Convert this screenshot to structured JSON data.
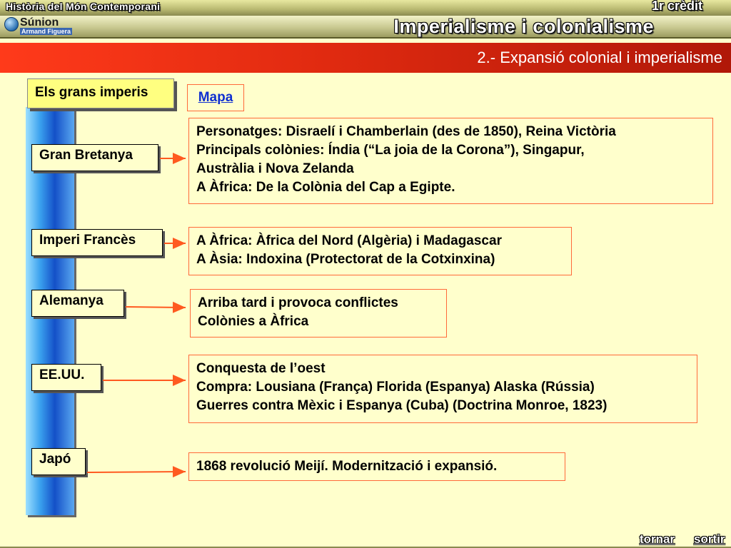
{
  "header": {
    "course": "Història del Món Contemporani",
    "credit": "1r crèdit",
    "title": "Imperialisme i colonialisme",
    "logo_word": "Súnion",
    "logo_author": "Armand Figuera"
  },
  "section": {
    "title": "2.- Expansió colonial i imperialisme"
  },
  "sidebar_header": "Els grans imperis",
  "map_link": "Mapa",
  "empires": [
    {
      "name": "Gran Bretanya",
      "lines": [
        "Personatges: Disraelí i Chamberlain (des de 1850), Reina Victòria",
        "Principals colònies: Índia (“La joia de la Corona”), Singapur,",
        "Austràlia i Nova Zelanda",
        "A Àfrica: De la Colònia del Cap a Egipte."
      ]
    },
    {
      "name": "Imperi Francès",
      "lines": [
        "A Àfrica: Àfrica del Nord (Algèria) i Madagascar",
        "A Àsia: Indoxina (Protectorat de la Cotxinxina)"
      ]
    },
    {
      "name": "Alemanya",
      "lines": [
        "Arriba tard i provoca conflictes",
        "Colònies a Àfrica"
      ]
    },
    {
      "name": "EE.UU.",
      "lines": [
        "Conquesta de l’oest",
        "Compra: Lousiana (França) Florida (Espanya) Alaska (Rússia)",
        "Guerres contra Mèxic i Espanya (Cuba) (Doctrina Monroe, 1823)"
      ]
    },
    {
      "name": "Japó",
      "lines": [
        "1868 revolució Meijí. Modernització i expansió."
      ]
    }
  ],
  "footer": {
    "back": "tornar",
    "exit": "sortir"
  },
  "colors": {
    "background": "#ffffcc",
    "accent_red": "#e02a10",
    "border_orange": "#ff6a3a",
    "link_blue": "#1030d0"
  }
}
